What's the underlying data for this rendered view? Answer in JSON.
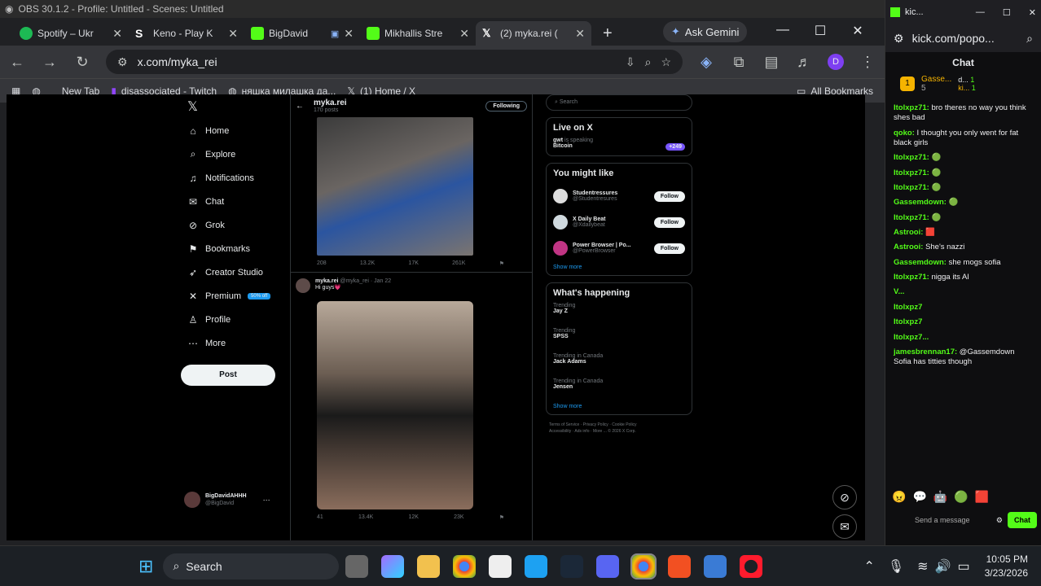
{
  "obs": {
    "title": "OBS 30.1.2 - Profile: Untitled - Scenes: Untitled"
  },
  "tabs": [
    {
      "label": "Spotify – Ukr",
      "color": "#1db954"
    },
    {
      "label": "Keno - Play K",
      "color": "#ffffff"
    },
    {
      "label": "BigDavid",
      "color": "#53fc18"
    },
    {
      "label": "Mikhallis Stre",
      "color": "#53fc18"
    },
    {
      "label": "(2) myka.rei (",
      "color": "#ffffff"
    }
  ],
  "gemini": {
    "label": "Ask Gemini"
  },
  "address": {
    "url": "x.com/myka_rei"
  },
  "profile_initial": "D",
  "bookmarks": [
    {
      "label": "New Tab"
    },
    {
      "label": "disassociated - Twitch"
    },
    {
      "label": "няшка милашка да..."
    },
    {
      "label": "(1) Home / X"
    }
  ],
  "all_bookmarks": "All Bookmarks",
  "xnav": {
    "items": [
      {
        "label": "Home",
        "icon": "home-icon",
        "glyph": "⌂"
      },
      {
        "label": "Explore",
        "icon": "search-icon",
        "glyph": "⌕"
      },
      {
        "label": "Notifications",
        "icon": "bell-icon",
        "glyph": "♫"
      },
      {
        "label": "Chat",
        "icon": "mail-icon",
        "glyph": "✉"
      },
      {
        "label": "Grok",
        "icon": "grok-icon",
        "glyph": "⊘"
      },
      {
        "label": "Bookmarks",
        "icon": "bookmark-icon",
        "glyph": "⚑"
      },
      {
        "label": "Creator Studio",
        "icon": "rocket-icon",
        "glyph": "➶"
      },
      {
        "label": "Premium",
        "icon": "x-icon",
        "glyph": "✕"
      },
      {
        "label": "Profile",
        "icon": "person-icon",
        "glyph": "♙"
      },
      {
        "label": "More",
        "icon": "more-icon",
        "glyph": "⋯"
      }
    ],
    "premium_badge": "50% off",
    "post": "Post",
    "account": {
      "name": "BigDavidAHHH",
      "handle": "@BigDavid"
    }
  },
  "feed": {
    "profile_name": "myka.rei",
    "posts_count": "170 posts",
    "following": "Following",
    "post1_stats": [
      "208",
      "13.2K",
      "17K",
      "261K"
    ],
    "post2": {
      "author": "myka.rei",
      "handle": "@myka_rei · Jan 22",
      "text": "Hi guys💗"
    },
    "post2_stats": [
      "41",
      "13.4K",
      "12K",
      "23K"
    ]
  },
  "side": {
    "search": "Search",
    "live": {
      "title": "Live on X",
      "host": "gwt",
      "speaking": "is speaking",
      "topic": "Bitcoin",
      "count": "+249"
    },
    "ymlike": {
      "title": "You might like",
      "show_more": "Show more",
      "people": [
        {
          "name": "Studentressures",
          "handle": "@Studentresures"
        },
        {
          "name": "X Daily Beat",
          "handle": "@Xdailybeat"
        },
        {
          "name": "Power Browser | Po...",
          "handle": "@PowerBrowser"
        }
      ],
      "follow": "Follow"
    },
    "happening": {
      "title": "What's happening",
      "items": [
        {
          "ctx": "Trending",
          "topic": "Jay Z"
        },
        {
          "ctx": "Trending",
          "topic": "SPSS"
        },
        {
          "ctx": "Trending in Canada",
          "topic": "Jack Adams"
        },
        {
          "ctx": "Trending in Canada",
          "topic": "Jensen"
        }
      ],
      "show_more": "Show more"
    },
    "footer": [
      "Terms of Service",
      "Privacy Policy",
      "Cookie Policy",
      "Accessibility",
      "Ads info",
      "More ...",
      "© 2026 X Corp."
    ]
  },
  "chat": {
    "window_title": "kic...",
    "url": "kick.com/popo...",
    "header": "Chat",
    "top_gifter": {
      "rank": "1",
      "name": "Gasse...",
      "count": "5"
    },
    "top_other": [
      {
        "name": "d...",
        "count": "1"
      },
      {
        "name": "ki...",
        "count": "1"
      }
    ],
    "messages": [
      {
        "user": "Itolxpz71:",
        "text": "bro theres no way you think shes bad"
      },
      {
        "user": "qoko:",
        "text": "I thought you only went for fat black girls"
      },
      {
        "user": "Itolxpz71:",
        "text": "🟢"
      },
      {
        "user": "Itolxpz71:",
        "text": "🟢"
      },
      {
        "user": "Itolxpz71:",
        "text": "🟢"
      },
      {
        "user": "Gassemdown:",
        "text": "🟢"
      },
      {
        "user": "Itolxpz71:",
        "text": "🟢"
      },
      {
        "user": "Astrooi:",
        "text": "🟥"
      },
      {
        "user": "Astrooi:",
        "text": "She's nazzi"
      },
      {
        "user": "Gassemdown:",
        "text": "she mogs sofia"
      },
      {
        "user": "Itolxpz71:",
        "text": "nigga its AI"
      },
      {
        "user": "V...",
        "text": ""
      },
      {
        "user": "Itolxpz7",
        "text": ""
      },
      {
        "user": "Itolxpz7",
        "text": ""
      },
      {
        "user": "Itolxpz7...",
        "text": ""
      },
      {
        "user": "jamesbrennan17:",
        "text": "@Gassemdown Sofia has titties though"
      }
    ],
    "input_placeholder": "Send a message",
    "send": "Chat"
  },
  "taskbar": {
    "search": "Search",
    "time": "10:05 PM",
    "date": "3/23/2026"
  }
}
